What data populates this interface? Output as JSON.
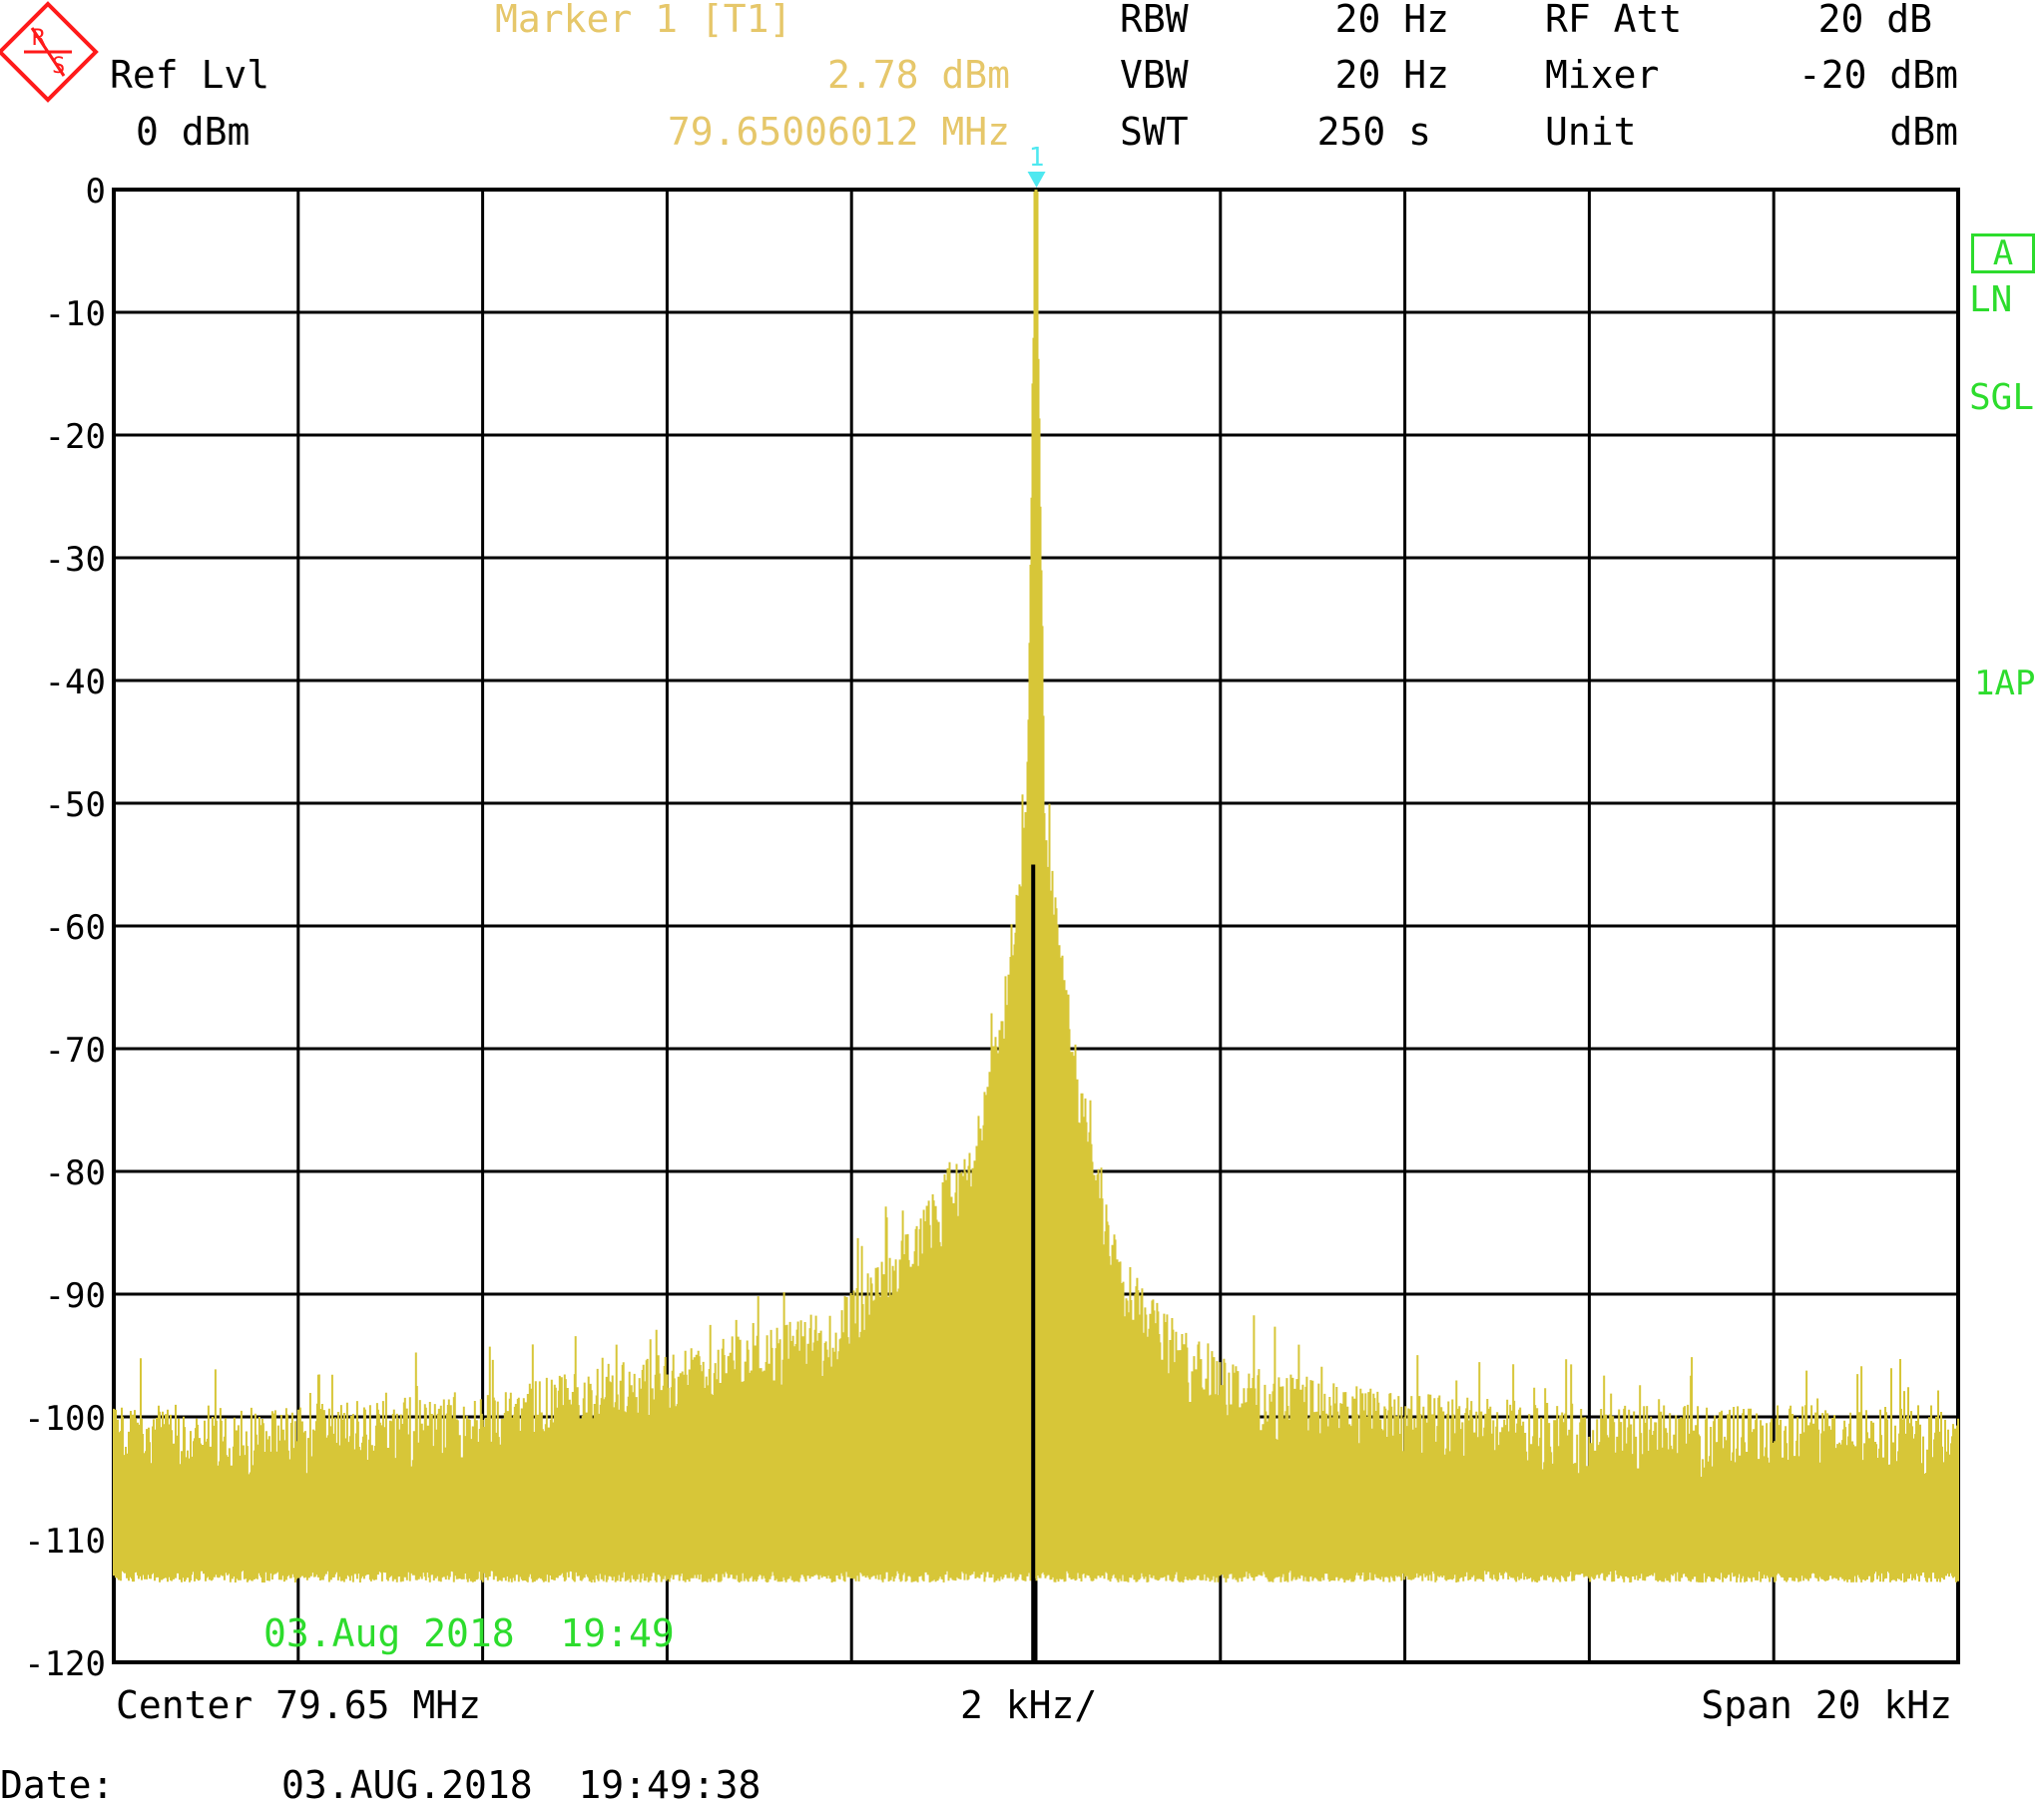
{
  "header": {
    "marker_label": "Marker 1 [T1]",
    "marker_level": "2.78 dBm",
    "marker_freq": "79.65006012 MHz",
    "ref_lvl_label": "Ref Lvl",
    "ref_lvl_value": "0 dBm",
    "rbw_label": "RBW",
    "rbw_value": "20 Hz",
    "vbw_label": "VBW",
    "vbw_value": "20 Hz",
    "swt_label": "SWT",
    "swt_value": "250 s",
    "rf_att_label": "RF Att",
    "rf_att_value": "20 dB",
    "mixer_label": "Mixer",
    "mixer_value": "-20 dBm",
    "unit_label": "Unit",
    "unit_value": "dBm"
  },
  "logo": {
    "letters": "R&S"
  },
  "side": {
    "trace_badge": "A",
    "ln": "LN",
    "sgl": "SGL",
    "ap": "1AP"
  },
  "footer": {
    "center": "Center 79.65 MHz",
    "div": "2 kHz/",
    "span": "Span 20 kHz",
    "date_label": "Date:",
    "date_value": "03.AUG.2018  19:49:38",
    "timestamp_in_plot": "03.Aug 2018  19:49"
  },
  "marker": {
    "number": "1"
  },
  "colors": {
    "trace": "#d7c638",
    "marker": "#4fe8f0",
    "label_yellow": "#e6c76a",
    "status_green": "#2ddc2d",
    "grid": "#000000"
  },
  "chart_data": {
    "type": "line",
    "x_unit": "kHz offset",
    "xlim": [
      -10,
      10
    ],
    "ylim": [
      -120,
      0
    ],
    "y_ticks": [
      "0",
      "-10",
      "-20",
      "-30",
      "-40",
      "-50",
      "-60",
      "-70",
      "-80",
      "-90",
      "-100",
      "-110",
      "-120"
    ],
    "grid": true,
    "x_divisions": 10,
    "y_divisions": 12,
    "trace": {
      "shape_points": [
        [
          -10,
          -104
        ],
        [
          -8,
          -104
        ],
        [
          -6,
          -103
        ],
        [
          -4.4,
          -100
        ],
        [
          -3.0,
          -98
        ],
        [
          -2.2,
          -96
        ],
        [
          -1.4,
          -90
        ],
        [
          -1.0,
          -85
        ],
        [
          -0.6,
          -80
        ],
        [
          -0.3,
          -68
        ],
        [
          -0.1,
          -55
        ],
        [
          0.0,
          2.78
        ],
        [
          0.1,
          -55
        ],
        [
          0.3,
          -68
        ],
        [
          0.6,
          -82
        ],
        [
          1.0,
          -92
        ],
        [
          1.6,
          -98
        ],
        [
          2.5,
          -101
        ],
        [
          4,
          -103
        ],
        [
          6,
          -104
        ],
        [
          8,
          -104
        ],
        [
          10,
          -104
        ]
      ],
      "noise_floor": -104,
      "noise_floor_min": -113.5
    },
    "marker": {
      "x": 0.006012,
      "y": 2.78
    }
  }
}
